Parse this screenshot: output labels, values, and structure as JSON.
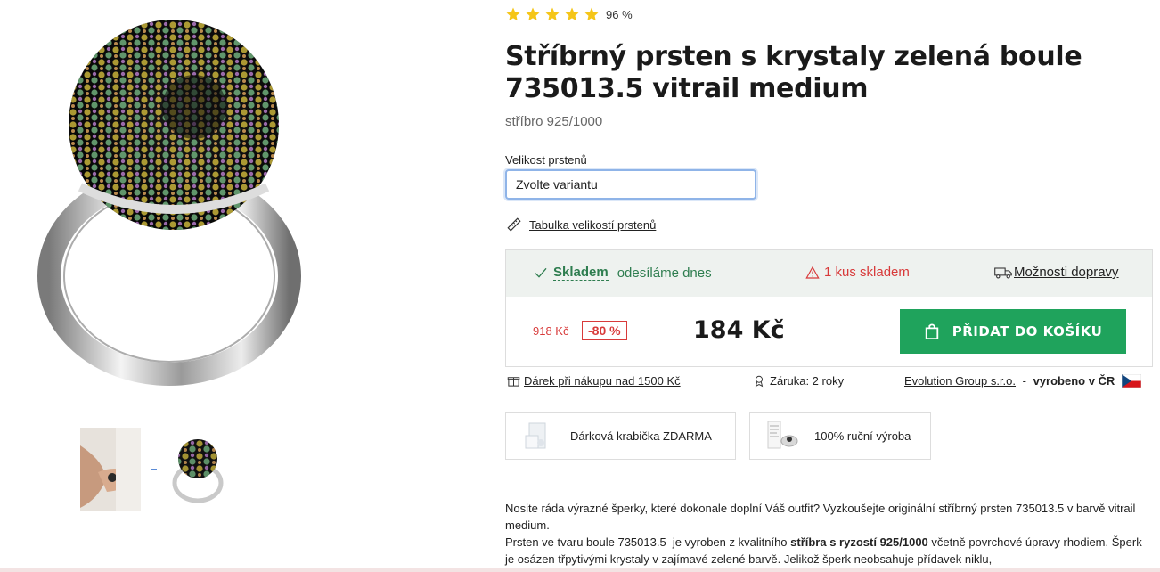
{
  "rating": {
    "stars": 5,
    "percent": "96 %"
  },
  "product": {
    "title": "Stříbrný prsten s krystaly zelená boule 735013.5 vitrail medium",
    "subtitle": "stříbro 925/1000"
  },
  "variant": {
    "label": "Velikost prstenů",
    "value": "Zvolte variantu"
  },
  "size_table": {
    "label": "Tabulka velikostí prstenů",
    "icon": "ruler-icon"
  },
  "stock": {
    "status": "Skladem",
    "shipping": "odesíláme dnes",
    "warning": "1 kus skladem",
    "delivery": "Možnosti dopravy"
  },
  "pricing": {
    "old_price": "918 Kč",
    "discount": "-80 %",
    "price": "184 Kč",
    "cart_button": "PŘIDAT DO KOŠÍKU"
  },
  "info": {
    "gift": "Dárek při nákupu nad 1500 Kč",
    "warranty": "Záruka: 2 roky",
    "maker_link": "Evolution Group s.r.o.",
    "maker_sep": " - ",
    "maker_made": "vyrobeno v ČR"
  },
  "features": [
    {
      "label": "Dárková krabička ZDARMA"
    },
    {
      "label": "100% ruční výroba"
    }
  ],
  "description": {
    "p1": "Nosite ráda výrazné šperky, které dokonale doplní Váš outfit? Vyzkoušejte originální stříbrný prsten 735013.5 v barvě vitrail medium.",
    "p2_a": "Prsten ve tvaru boule 735013.5  je vyroben z kvalitního ",
    "p2_bold": "stříbra s ryzostí 925/1000",
    "p2_b": " včetně povrchové úpravy rhodiem. Šperk je osázen třpytivými krystaly v zajímavé zelené barvě. Jelikož šperk neobsahuje přídavek niklu,"
  },
  "colors": {
    "accent_green": "#1fa35c",
    "stock_green": "#2e7d4f",
    "warning_red": "#d83a3a",
    "star": "#f5c518"
  }
}
